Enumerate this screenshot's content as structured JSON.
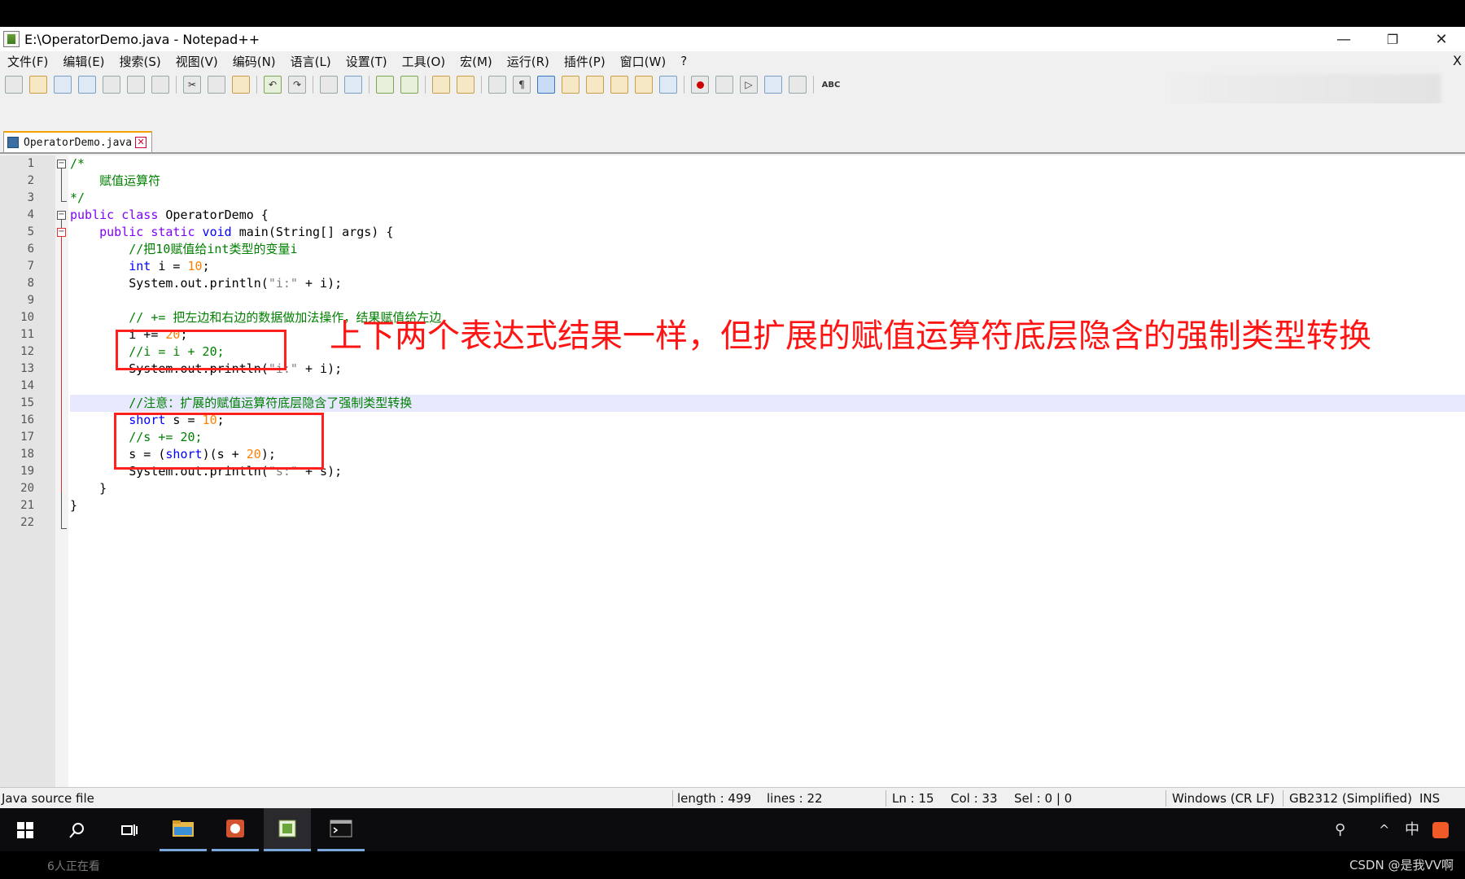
{
  "window": {
    "title": "E:\\OperatorDemo.java - Notepad++",
    "controls": {
      "minimize": "—",
      "restore": "❐",
      "close": "✕"
    }
  },
  "menu": {
    "items": [
      "文件(F)",
      "编辑(E)",
      "搜索(S)",
      "视图(V)",
      "编码(N)",
      "语言(L)",
      "设置(T)",
      "工具(O)",
      "宏(M)",
      "运行(R)",
      "插件(P)",
      "窗口(W)",
      "?"
    ],
    "close_label": "X"
  },
  "toolbar": {
    "buttons": [
      "new-file-icon",
      "open-file-icon",
      "save-icon",
      "save-all-icon",
      "close-icon",
      "close-all-icon",
      "print-icon",
      "cut-icon",
      "copy-icon",
      "paste-icon",
      "undo-icon",
      "redo-icon",
      "find-icon",
      "replace-icon",
      "zoom-in-icon",
      "zoom-out-icon",
      "sync-v-icon",
      "sync-h-icon",
      "word-wrap-icon",
      "show-all-chars-icon",
      "indent-guide-icon",
      "doc-map-icon",
      "function-list-icon",
      "folder-workspace-icon",
      "monitor-icon",
      "eye-icon",
      "record-macro-icon",
      "stop-record-icon",
      "play-macro-icon",
      "run-macro-multiple-icon",
      "save-macro-icon",
      "spellcheck-icon"
    ],
    "spellcheck_label": "ABC"
  },
  "tab": {
    "label": "OperatorDemo.java",
    "close_glyph": "✕"
  },
  "editor": {
    "line_numbers": [
      "1",
      "2",
      "3",
      "4",
      "5",
      "6",
      "7",
      "8",
      "9",
      "10",
      "11",
      "12",
      "13",
      "14",
      "15",
      "16",
      "17",
      "18",
      "19",
      "20",
      "21",
      "22"
    ],
    "current_line": 15
  },
  "annotation": {
    "text": "上下两个表达式结果一样，但扩展的赋值运算符底层隐含的强制类型转换"
  },
  "status": {
    "file_type": "Java source file",
    "length": "length : 499",
    "lines": "lines : 22",
    "ln": "Ln : 15",
    "col": "Col : 33",
    "sel": "Sel : 0 | 0",
    "eol": "Windows (CR LF)",
    "encoding": "GB2312 (Simplified)",
    "mode": "INS"
  },
  "taskbar": {
    "tray_ime": "中",
    "tray_up": "^"
  },
  "overlay": {
    "viewers": "6人正在看",
    "watermark": "CSDN @是我VV啊"
  },
  "colors": {
    "keyword": "#8000ff",
    "type": "#0000ff",
    "comment": "#008000",
    "number": "#ff8000",
    "string": "#808080",
    "annotation": "#ff1414",
    "current_line": "#e8e8ff"
  }
}
